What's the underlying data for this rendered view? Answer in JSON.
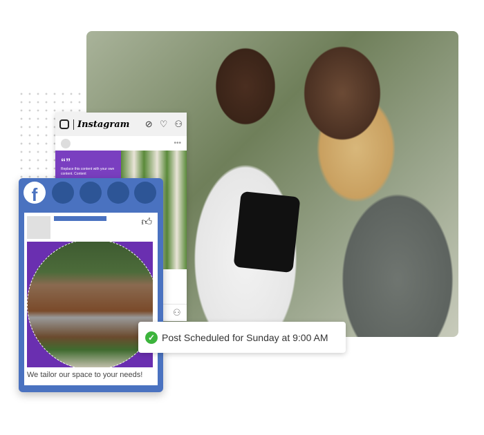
{
  "instagram": {
    "logo": "Instagram",
    "quote_mark": "“”",
    "placeholder_text": "Replace this content with your own content. Content",
    "icons": [
      "instagram-icon",
      "compass-icon",
      "heart-icon",
      "user-icon",
      "more-icon"
    ]
  },
  "facebook": {
    "icons": [
      "facebook-icon",
      "thumbs-up-icon"
    ],
    "caption": "We tailor our space to your needs!",
    "accent": "#4a72c0"
  },
  "toast": {
    "message": "Post Scheduled for Sunday at 9:00 AM",
    "status_color": "#3cb43c"
  }
}
